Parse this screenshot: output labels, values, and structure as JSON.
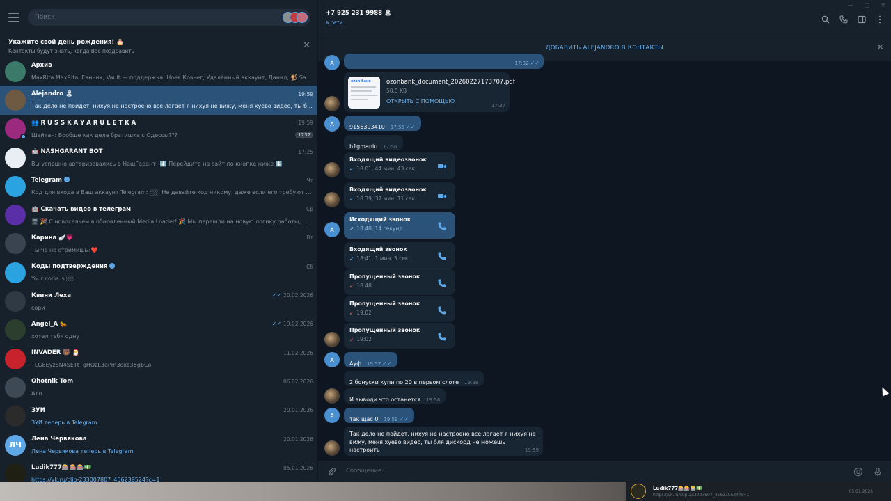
{
  "window": {
    "controls": [
      "—",
      "▢",
      "✕"
    ]
  },
  "sidebar": {
    "search_placeholder": "Поиск",
    "birthday": {
      "title": "Укажите свой день рождения! 🎂",
      "subtitle": "Контакты будут знать, когда Вас поздравить"
    },
    "chats": [
      {
        "name": "Архив",
        "preview": "MaxRita MaxRita, Ганник, Vault — поддержка, Ноев Ковчег, Удалённый аккаунт, Данил, 🐒 Satur...",
        "date": "",
        "avatar_color": "#3b7a68",
        "avatar_text": ""
      },
      {
        "name": "Alejandro 🏝",
        "preview": "Так дело не пойдет, нихуя не настроено все лагает я нихуя не вижу, меня хуево видео, ты бля ди...",
        "date": "19:59",
        "avatar_color": "#6e5a42",
        "avatar_text": ""
      },
      {
        "name": "👥 R U S S K A Y A R U L E T K A",
        "preview": "Шайтан: Вообще как дела братишка с Одессы???",
        "date": "19:59",
        "badge": "1232",
        "avatar_color": "#9b2a7e",
        "avatar_text": ""
      },
      {
        "name": "🤖 NASHGARANT BOT",
        "preview": "Вы успешно авторизовались в НашГарант! ⬇️ Перейдите на сайт по кнопке ниже ⬇️",
        "date": "17:25",
        "avatar_color": "#e8eef4",
        "avatar_text": ""
      },
      {
        "name": "Telegram",
        "preview": "Код для входа в Ваш аккаунт Telegram: ░░. Не давайте код никому, даже если его требуют от ...",
        "date": "Чт",
        "avatar_color": "#2aa3e0",
        "avatar_text": "",
        "verified": true
      },
      {
        "name": "🤖 Скачать видео в телеграм",
        "preview": "🖥 🎉 С новосельем в обновленный Media Loader! 🎉 Мы перешли на новую логику работы, ...",
        "date": "Ср",
        "avatar_color": "#5a2ea6",
        "avatar_text": ""
      },
      {
        "name": "Карина 🪽💗",
        "preview": "Ты че не стримишь?❤️",
        "date": "Вт",
        "avatar_color": "#3a4450",
        "avatar_text": ""
      },
      {
        "name": "Коды подтверждения",
        "preview": "Your code is ░░",
        "date": "Сб",
        "avatar_color": "#2aa3e0",
        "avatar_text": "",
        "verified": true
      },
      {
        "name": "Квини Леха",
        "preview": "сори",
        "date": "20.02.2026",
        "avatar_color": "#2f3a44",
        "avatar_text": "",
        "read": true
      },
      {
        "name": "Angel_A 🐆",
        "preview": "хотел тебя одну",
        "date": "19.02.2026",
        "avatar_color": "#2c3e2d",
        "avatar_text": "",
        "read": true
      },
      {
        "name": "INVADER 🐻 🎅",
        "preview": "TLG8Eyz8N4SETtTgHQzL3aPm3oxe35gbCo",
        "date": "11.02.2026",
        "avatar_color": "#c8232d",
        "avatar_text": ""
      },
      {
        "name": "Ohotnik Tom",
        "preview": "Ало",
        "date": "06.02.2026",
        "avatar_color": "#3d4a56",
        "avatar_text": ""
      },
      {
        "name": "ЗУЙ",
        "preview": "ЗУЙ теперь в Telegram",
        "date": "20.01.2026",
        "avatar_color": "#2b2b2b",
        "avatar_text": "",
        "link": true
      },
      {
        "name": "Лена Червякова",
        "preview": "Лена Червякова теперь в Telegram",
        "date": "20.01.2026",
        "avatar_color": "#5fa8e8",
        "avatar_text": "ЛЧ",
        "link": true
      },
      {
        "name": "Ludik777🎰🎰🎰💵",
        "preview": "https://vk.ru/clip-233007807_456239524?c=1",
        "date": "05.01.2026",
        "avatar_color": "#1f1f14",
        "avatar_text": "",
        "link": true
      }
    ]
  },
  "chat": {
    "peer_name": "+7 925 231 9988 🏝",
    "peer_status": "в сети",
    "add_contact": "ДОБАВИТЬ ALEJANDRO В КОНТАКТЫ",
    "composer_placeholder": "Сообщение...",
    "messages": {
      "first_time": "17:32",
      "file_name": "ozonbank_document_20260227173707.pdf",
      "file_size": "50.5 KB",
      "file_action": "ОТКРЫТЬ С ПОМОЩЬЮ",
      "file_time": "17:37",
      "m1_text": "9156393410",
      "m1_time": "17:55",
      "m2_text": "b1gmanlu",
      "m2_time": "17:56",
      "c1_title": "Входящий видеозвонок",
      "c1_sub": "18:01, 44 мин. 43 сек.",
      "c2_title": "Входящий видеозвонок",
      "c2_sub": "18:39, 37 мин. 11 сек.",
      "c3_title": "Исходящий звонок",
      "c3_sub": "18:40, 14 секунд",
      "c4_title": "Входящий звонок",
      "c4_sub": "18:41, 1 мин. 5 сек.",
      "c5_title": "Пропущенный звонок",
      "c5_sub": "18:48",
      "c6_title": "Пропущенный звонок",
      "c6_sub": "19:02",
      "c7_title": "Пропущенный звонок",
      "c7_sub": "19:02",
      "m3_text": "Ауф",
      "m3_time": "19:57",
      "m4_text": "2 бонуски купи по 20 в первом слоте",
      "m4_time": "19:58",
      "m5_text": "И выводи что останется",
      "m5_time": "19:58",
      "m6_text": "так щас 0",
      "m6_time": "19:59",
      "m7_text": "Так дело не пойдет, нихуя не настроено все лагает я нихуя не вижу, меня хуево видео, ты бля дискорд не можешь настроить",
      "m7_time": "19:59",
      "avatar_letter": "A",
      "pdf_brand": "ozon банк"
    }
  },
  "notification": {
    "title": "Ludik777🎰🎰🎰💵",
    "link": "https://vk.ru/clip-233007807_456239524?c=1",
    "date": "05.01.2026"
  }
}
